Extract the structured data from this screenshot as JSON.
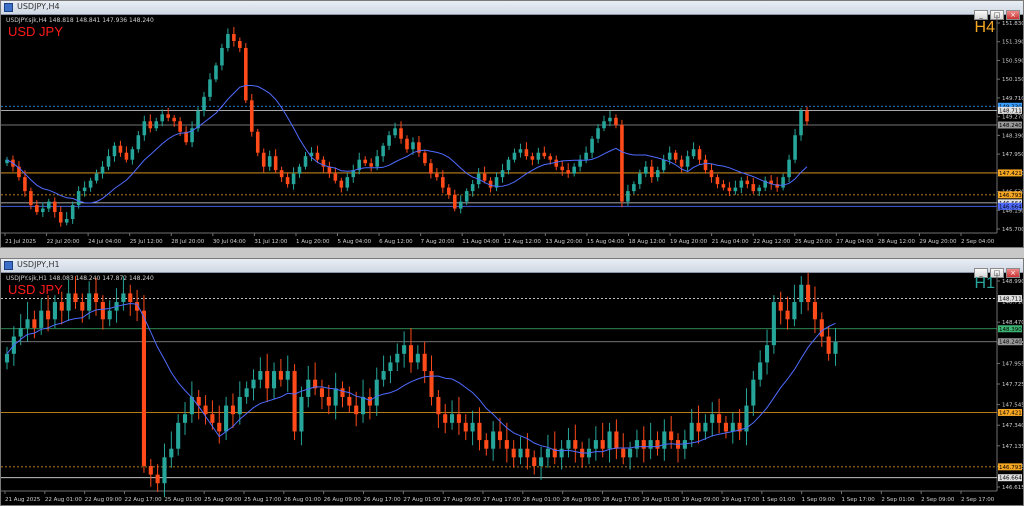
{
  "colors": {
    "bull": "#26a69a",
    "bear": "#ff4a1a",
    "ma": "#4f6bff",
    "axis_text": "#d0d0d0",
    "orange_line": "#f5a623",
    "white_line": "#e0e0e0",
    "green_line": "#3cb371"
  },
  "windows": [
    {
      "title": "USDJPY,H4",
      "info": "USDJPY.sjk,H4 148.818 148.841 147.936 148.240",
      "symbol": "USD JPY",
      "timeframe": "H4",
      "timeframe_color": "#f5a623",
      "buttons": [
        "_",
        "□",
        "×"
      ],
      "chart_data": {
        "type": "candlestick",
        "ylim": [
          145.7,
          151.83
        ],
        "price_ticks": [
          "151.830",
          "151.390",
          "150.590",
          "150.150",
          "149.710",
          "149.270",
          "148.390",
          "147.950",
          "147.510",
          "146.630",
          "146.190",
          "145.700"
        ],
        "x_labels": [
          "21 Jul 2025",
          "22 Jul 20:00",
          "24 Jul 04:00",
          "25 Jul 12:00",
          "28 Jul 20:00",
          "30 Jul 04:00",
          "31 Jul 12:00",
          "1 Aug 20:00",
          "5 Aug 04:00",
          "6 Aug 12:00",
          "7 Aug 20:00",
          "11 Aug 04:00",
          "12 Aug 12:00",
          "13 Aug 20:00",
          "15 Aug 04:00",
          "18 Aug 12:00",
          "19 Aug 20:00",
          "21 Aug 04:00",
          "22 Aug 12:00",
          "25 Aug 20:00",
          "27 Aug 04:00",
          "28 Aug 12:00",
          "29 Aug 20:00",
          "2 Sep 04:00"
        ],
        "levels": [
          {
            "price": 149.33,
            "label": "149.330",
            "style": "dot",
            "color": "#3aa0ff"
          },
          {
            "price": 149.212,
            "label": "148.711",
            "style": "solid",
            "color": "#e0e0e0"
          },
          {
            "price": 148.793,
            "label": "148.240",
            "style": "solid",
            "color": "#9a9a9a"
          },
          {
            "price": 147.421,
            "label": "147.421",
            "style": "solid",
            "color": "#f5a623"
          },
          {
            "price": 146.793,
            "label": "146.793",
            "style": "dot",
            "color": "#f5a623"
          },
          {
            "price": 146.564,
            "label": "146.564",
            "style": "solid",
            "color": "#e0e0e0"
          },
          {
            "price": 146.464,
            "label": "146.664",
            "style": "solid",
            "color": "#4f6bff"
          }
        ],
        "closes": [
          147.8,
          147.6,
          147.3,
          146.9,
          146.5,
          146.3,
          146.4,
          146.6,
          146.3,
          146.0,
          146.1,
          146.5,
          146.9,
          147.0,
          147.2,
          147.4,
          147.6,
          147.9,
          148.2,
          148.0,
          147.8,
          148.1,
          148.5,
          148.9,
          148.7,
          148.9,
          149.1,
          149.0,
          148.9,
          148.6,
          148.3,
          148.7,
          149.2,
          149.6,
          150.1,
          150.5,
          151.0,
          151.4,
          151.2,
          151.0,
          149.5,
          148.6,
          148.0,
          147.6,
          147.9,
          147.5,
          147.3,
          147.1,
          147.4,
          147.6,
          147.9,
          148.0,
          147.8,
          147.6,
          147.4,
          147.2,
          147.0,
          147.3,
          147.5,
          147.8,
          147.7,
          147.6,
          147.9,
          148.2,
          148.5,
          148.7,
          148.4,
          148.1,
          148.3,
          148.0,
          147.7,
          147.4,
          147.3,
          147.0,
          146.8,
          146.4,
          146.6,
          146.9,
          147.1,
          147.4,
          147.2,
          147.0,
          147.3,
          147.5,
          147.8,
          148.0,
          148.1,
          147.9,
          147.8,
          148.0,
          147.9,
          147.8,
          147.6,
          147.5,
          147.4,
          147.6,
          147.8,
          148.0,
          148.4,
          148.7,
          148.9,
          149.0,
          148.8,
          146.6,
          146.9,
          147.1,
          147.4,
          147.6,
          147.3,
          147.5,
          147.8,
          148.0,
          147.8,
          147.6,
          147.9,
          148.1,
          147.8,
          147.5,
          147.3,
          147.1,
          147.0,
          146.9,
          147.0,
          147.2,
          147.1,
          146.9,
          147.0,
          147.2,
          147.1,
          147.0,
          147.3,
          147.8,
          148.5,
          149.2,
          148.9
        ]
      }
    },
    {
      "title": "USDJPY,H1",
      "info": "USDJPY.sjk,H1 148.083 148.240 147.872 148.240",
      "symbol": "USD JPY",
      "timeframe": "H1",
      "timeframe_color": "#26a69a",
      "buttons": [
        "_",
        "□",
        "×"
      ],
      "chart_data": {
        "type": "candlestick",
        "ylim": [
          146.51,
          148.99
        ],
        "price_ticks": [
          "148.990",
          "148.710",
          "148.470",
          "148.265",
          "147.955",
          "147.725",
          "147.545",
          "147.340",
          "147.135",
          "146.825",
          "146.615"
        ],
        "x_labels": [
          "21 Aug 2025",
          "22 Aug 01:00",
          "22 Aug 09:00",
          "22 Aug 17:00",
          "25 Aug 01:00",
          "25 Aug 09:00",
          "25 Aug 17:00",
          "26 Aug 01:00",
          "26 Aug 09:00",
          "26 Aug 17:00",
          "27 Aug 01:00",
          "27 Aug 09:00",
          "27 Aug 17:00",
          "28 Aug 01:00",
          "28 Aug 09:00",
          "28 Aug 17:00",
          "29 Aug 01:00",
          "29 Aug 09:00",
          "29 Aug 17:00",
          "1 Sep 01:00",
          "1 Sep 09:00",
          "1 Sep 17:00",
          "2 Sep 01:00",
          "2 Sep 09:00",
          "2 Sep 17:00"
        ],
        "levels": [
          {
            "price": 148.74,
            "label": "148.711",
            "style": "dot",
            "color": "#e0e0e0"
          },
          {
            "price": 148.39,
            "label": "148.390",
            "style": "solid",
            "color": "#3cb371"
          },
          {
            "price": 148.24,
            "label": "148.240",
            "style": "solid",
            "color": "#9a9a9a"
          },
          {
            "price": 147.42,
            "label": "147.421",
            "style": "solid",
            "color": "#f5a623"
          },
          {
            "price": 146.79,
            "label": "146.793",
            "style": "dot",
            "color": "#f5a623"
          },
          {
            "price": 146.664,
            "label": "146.664",
            "style": "solid",
            "color": "#e0e0e0"
          }
        ],
        "closes": [
          148.1,
          148.3,
          148.4,
          148.5,
          148.4,
          148.6,
          148.5,
          148.7,
          148.6,
          148.8,
          148.7,
          148.6,
          148.8,
          148.7,
          148.5,
          148.6,
          148.7,
          148.8,
          148.7,
          148.6,
          146.8,
          146.7,
          146.6,
          146.9,
          147.0,
          147.3,
          147.4,
          147.6,
          147.5,
          147.4,
          147.3,
          147.2,
          147.5,
          147.4,
          147.6,
          147.7,
          147.8,
          147.9,
          147.7,
          147.9,
          147.8,
          147.9,
          147.2,
          147.6,
          147.8,
          147.7,
          147.6,
          147.5,
          147.7,
          147.6,
          147.5,
          147.4,
          147.6,
          147.5,
          147.8,
          147.9,
          148.0,
          148.1,
          148.2,
          148.0,
          148.1,
          147.9,
          147.6,
          147.4,
          147.3,
          147.4,
          147.3,
          147.2,
          147.3,
          147.1,
          147.0,
          147.2,
          147.1,
          147.0,
          146.9,
          147.0,
          146.9,
          146.8,
          146.9,
          147.0,
          146.9,
          147.0,
          147.1,
          147.0,
          146.9,
          147.0,
          147.1,
          147.0,
          147.2,
          147.0,
          146.9,
          147.0,
          147.1,
          147.0,
          147.1,
          147.0,
          147.2,
          147.1,
          147.0,
          147.1,
          147.3,
          147.2,
          147.3,
          147.4,
          147.3,
          147.2,
          147.3,
          147.2,
          147.5,
          147.8,
          148.0,
          148.2,
          148.7,
          148.6,
          148.5,
          148.7,
          148.9,
          148.7,
          148.5,
          148.3,
          148.1,
          148.24
        ]
      }
    }
  ]
}
